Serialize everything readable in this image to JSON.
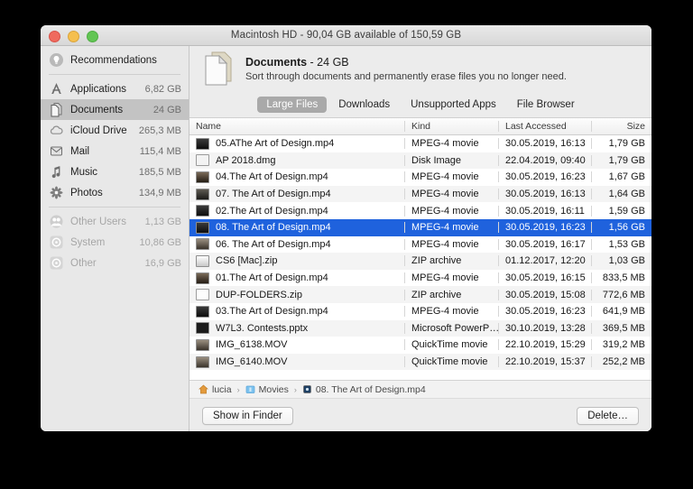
{
  "window": {
    "title": "Macintosh HD - 90,04 GB available of 150,59 GB",
    "traffic_lights": [
      "close-button",
      "minimize-button",
      "zoom-button"
    ]
  },
  "sidebar": {
    "items": [
      {
        "label": "Recommendations",
        "size": "",
        "icon": "lightbulb-icon",
        "state": "normal"
      },
      {
        "label": "Applications",
        "size": "6,82 GB",
        "icon": "applications-icon",
        "state": "normal"
      },
      {
        "label": "Documents",
        "size": "24 GB",
        "icon": "documents-icon",
        "state": "selected"
      },
      {
        "label": "iCloud Drive",
        "size": "265,3 MB",
        "icon": "icloud-icon",
        "state": "normal"
      },
      {
        "label": "Mail",
        "size": "115,4 MB",
        "icon": "mail-icon",
        "state": "normal"
      },
      {
        "label": "Music",
        "size": "185,5 MB",
        "icon": "music-note-icon",
        "state": "normal"
      },
      {
        "label": "Photos",
        "size": "134,9 MB",
        "icon": "photos-icon",
        "state": "normal"
      },
      {
        "label": "Other Users",
        "size": "1,13 GB",
        "icon": "users-icon",
        "state": "disabled"
      },
      {
        "label": "System",
        "size": "10,86 GB",
        "icon": "system-icon",
        "state": "disabled"
      },
      {
        "label": "Other",
        "size": "16,9 GB",
        "icon": "other-icon",
        "state": "disabled"
      }
    ]
  },
  "header": {
    "icon": "documents-stack-icon",
    "title": "Documents",
    "size": " - 24 GB",
    "subtitle": "Sort through documents and permanently erase files you no longer need."
  },
  "tabs": [
    {
      "label": "Large Files",
      "active": true
    },
    {
      "label": "Downloads",
      "active": false
    },
    {
      "label": "Unsupported Apps",
      "active": false
    },
    {
      "label": "File Browser",
      "active": false
    }
  ],
  "table": {
    "columns": [
      "Name",
      "Kind",
      "Last Accessed",
      "Size"
    ],
    "rows": [
      {
        "name": "05.AThe Art of Design.mp4",
        "kind": "MPEG-4 movie",
        "accessed": "30.05.2019, 16:13",
        "size": "1,79 GB",
        "icon": "movie-file-icon",
        "icon_class": "movie b1",
        "selected": false
      },
      {
        "name": "AP 2018.dmg",
        "kind": "Disk Image",
        "accessed": "22.04.2019, 09:40",
        "size": "1,79 GB",
        "icon": "disk-image-icon",
        "icon_class": "dmg",
        "selected": false
      },
      {
        "name": "04.The Art of Design.mp4",
        "kind": "MPEG-4 movie",
        "accessed": "30.05.2019, 16:23",
        "size": "1,67 GB",
        "icon": "movie-file-icon",
        "icon_class": "movie b2",
        "selected": false
      },
      {
        "name": "07. The Art of Design.mp4",
        "kind": "MPEG-4 movie",
        "accessed": "30.05.2019, 16:13",
        "size": "1,64 GB",
        "icon": "movie-file-icon",
        "icon_class": "movie b3",
        "selected": false
      },
      {
        "name": "02.The Art of Design.mp4",
        "kind": "MPEG-4 movie",
        "accessed": "30.05.2019, 16:11",
        "size": "1,59 GB",
        "icon": "movie-file-icon",
        "icon_class": "movie b1",
        "selected": false
      },
      {
        "name": "08. The Art of Design.mp4",
        "kind": "MPEG-4 movie",
        "accessed": "30.05.2019, 16:23",
        "size": "1,56 GB",
        "icon": "movie-file-icon",
        "icon_class": "movie b1",
        "selected": true
      },
      {
        "name": "06. The Art of Design.mp4",
        "kind": "MPEG-4 movie",
        "accessed": "30.05.2019, 16:17",
        "size": "1,53 GB",
        "icon": "movie-file-icon",
        "icon_class": "movie b4",
        "selected": false
      },
      {
        "name": "CS6 [Mac].zip",
        "kind": "ZIP archive",
        "accessed": "01.12.2017, 12:20",
        "size": "1,03 GB",
        "icon": "zip-archive-icon",
        "icon_class": "zip",
        "selected": false
      },
      {
        "name": "01.The Art of Design.mp4",
        "kind": "MPEG-4 movie",
        "accessed": "30.05.2019, 16:15",
        "size": "833,5 MB",
        "icon": "movie-file-icon",
        "icon_class": "movie b2",
        "selected": false
      },
      {
        "name": "DUP-FOLDERS.zip",
        "kind": "ZIP archive",
        "accessed": "30.05.2019, 15:08",
        "size": "772,6 MB",
        "icon": "zip-archive-icon",
        "icon_class": "doczip",
        "selected": false
      },
      {
        "name": "03.The Art of Design.mp4",
        "kind": "MPEG-4 movie",
        "accessed": "30.05.2019, 16:23",
        "size": "641,9 MB",
        "icon": "movie-file-icon",
        "icon_class": "movie b1",
        "selected": false
      },
      {
        "name": "W7L3. Contests.pptx",
        "kind": "Microsoft PowerP…",
        "accessed": "30.10.2019, 13:28",
        "size": "369,5 MB",
        "icon": "powerpoint-icon",
        "icon_class": "ppt",
        "selected": false
      },
      {
        "name": "IMG_6138.MOV",
        "kind": "QuickTime movie",
        "accessed": "22.10.2019, 15:29",
        "size": "319,2 MB",
        "icon": "quicktime-icon",
        "icon_class": "movie b4",
        "selected": false
      },
      {
        "name": "IMG_6140.MOV",
        "kind": "QuickTime movie",
        "accessed": "22.10.2019, 15:37",
        "size": "252,2 MB",
        "icon": "quicktime-icon",
        "icon_class": "movie b4",
        "selected": false
      }
    ]
  },
  "pathbar": {
    "crumbs": [
      {
        "label": "lucia",
        "icon": "home-icon"
      },
      {
        "label": "Movies",
        "icon": "folder-icon"
      },
      {
        "label": "08. The Art of Design.mp4",
        "icon": "movie-file-icon"
      }
    ],
    "separator": "›"
  },
  "footer": {
    "show_in_finder_label": "Show in Finder",
    "delete_label": "Delete…"
  },
  "colors": {
    "selection_blue": "#1f62dd",
    "tab_active_gray": "#a9a9a9",
    "window_chrome": "#ececec",
    "sidebar_bg": "#e8e8e8",
    "desktop_bg": "#000000"
  }
}
